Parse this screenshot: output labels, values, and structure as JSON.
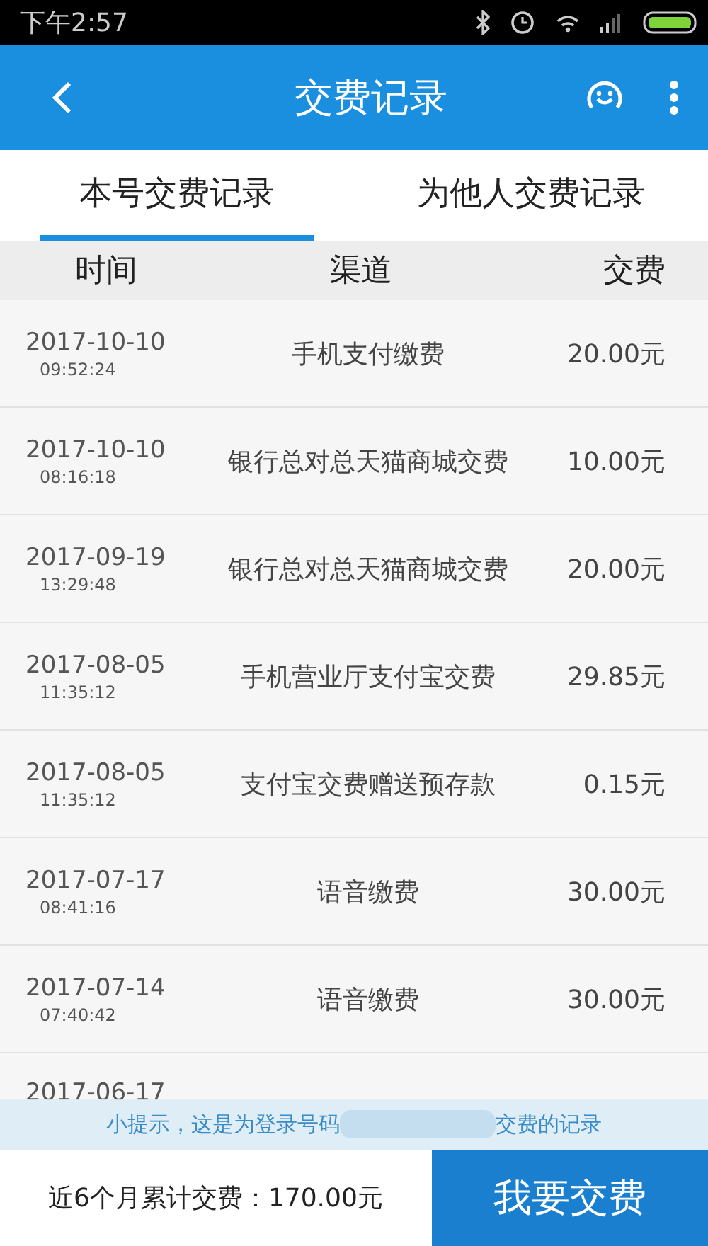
{
  "status_bar": {
    "time": "下午2:57"
  },
  "header": {
    "title": "交费记录"
  },
  "tabs": [
    {
      "label": "本号交费记录",
      "selected": true
    },
    {
      "label": "为他人交费记录",
      "selected": false
    }
  ],
  "table": {
    "columns": [
      "时间",
      "渠道",
      "交费"
    ],
    "rows": [
      {
        "date": "2017-10-10",
        "time": "09:52:24",
        "channel": "手机支付缴费",
        "amount": "20.00元"
      },
      {
        "date": "2017-10-10",
        "time": "08:16:18",
        "channel": "银行总对总天猫商城交费",
        "amount": "10.00元"
      },
      {
        "date": "2017-09-19",
        "time": "13:29:48",
        "channel": "银行总对总天猫商城交费",
        "amount": "20.00元"
      },
      {
        "date": "2017-08-05",
        "time": "11:35:12",
        "channel": "手机营业厅支付宝交费",
        "amount": "29.85元"
      },
      {
        "date": "2017-08-05",
        "time": "11:35:12",
        "channel": "支付宝交费赠送预存款",
        "amount": "0.15元"
      },
      {
        "date": "2017-07-17",
        "time": "08:41:16",
        "channel": "语音缴费",
        "amount": "30.00元"
      },
      {
        "date": "2017-07-14",
        "time": "07:40:42",
        "channel": "语音缴费",
        "amount": "30.00元"
      },
      {
        "date": "2017-06-17"
      }
    ]
  },
  "hint": {
    "before": "小提示，这是为登录号码",
    "after": "交费的记录"
  },
  "footer": {
    "total": "近6个月累计交费：170.00元",
    "button": "我要交费"
  }
}
